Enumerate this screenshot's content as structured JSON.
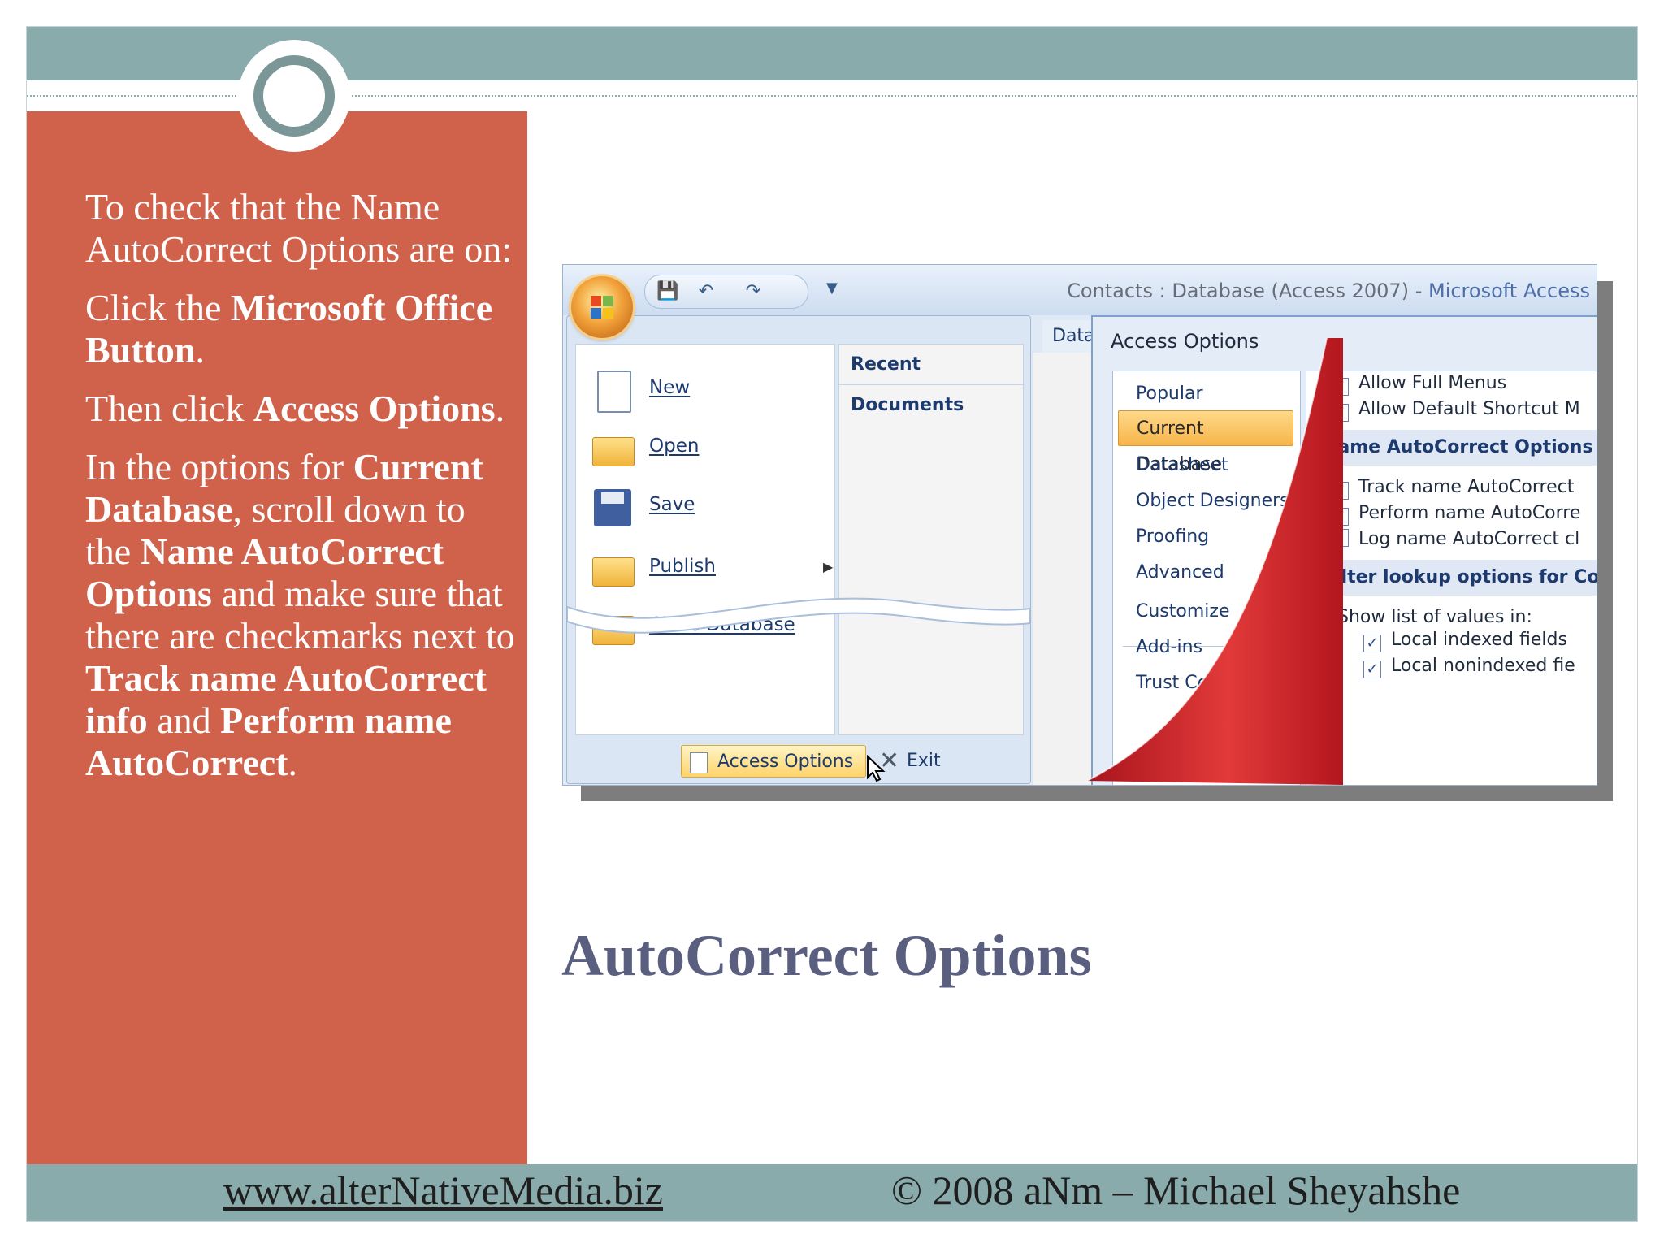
{
  "slide": {
    "title": "AutoCorrect Options",
    "footer_url": "www.alterNativeMedia.biz",
    "footer_copyright": "© 2008 aNm – Michael Sheyahshe"
  },
  "instructions": {
    "p1": "To check that the Name AutoCorrect Options are on:",
    "p2_pre": "Click the ",
    "p2_bold": "Microsoft Office Button",
    "p2_post": ".",
    "p3_pre": "Then click ",
    "p3_bold": "Access Options",
    "p3_post": ".",
    "p4_a": "In the options for ",
    "p4_b": "Current Database",
    "p4_c": ", scroll down to the ",
    "p4_d": "Name AutoCorrect Options",
    "p4_e": " and make sure that there are checkmarks next to ",
    "p4_f": "Track name AutoCorrect info",
    "p4_g": " and ",
    "p4_h": "Perform name AutoCorrect",
    "p4_i": "."
  },
  "screenshot": {
    "window_title_doc": "Contacts : Database (Access 2007)",
    "window_title_sep": " - ",
    "window_title_app": "Microsoft Access",
    "office_menu": {
      "recent_documents_header": "Recent Documents",
      "items": [
        {
          "label": "New",
          "icon": "new-document-icon"
        },
        {
          "label": "Open",
          "icon": "open-folder-icon"
        },
        {
          "label": "Save",
          "icon": "save-disk-icon"
        },
        {
          "label": "Publish",
          "icon": "publish-icon"
        },
        {
          "label": "Close Database",
          "icon": "close-database-icon"
        }
      ],
      "access_options_label": "Access Options",
      "exit_label": "Exit Access"
    },
    "background_tab": "Data",
    "dialog": {
      "title": "Access Options",
      "nav": [
        "Popular",
        "Current Database",
        "Datasheet",
        "Object Designers",
        "Proofing",
        "Advanced",
        "Customize",
        "Add-ins",
        "Trust Center"
      ],
      "selected_nav": "Current Database",
      "checks_top": [
        {
          "label": "Allow Full Menus",
          "checked": true
        },
        {
          "label": "Allow Default Shortcut M",
          "checked": true
        }
      ],
      "name_autocorrect_header": "Name AutoCorrect Options",
      "name_autocorrect": [
        {
          "label": "Track name AutoCorrect",
          "checked": true
        },
        {
          "label": "Perform name AutoCorre",
          "checked": true
        },
        {
          "label": "Log name AutoCorrect cl",
          "checked": false
        }
      ],
      "filter_header": "Filter lookup options for Con",
      "show_list_label": "Show list of values in:",
      "filter_checks": [
        {
          "label": "Local indexed fields",
          "checked": true
        },
        {
          "label": "Local nonindexed fie",
          "checked": true
        }
      ]
    }
  }
}
